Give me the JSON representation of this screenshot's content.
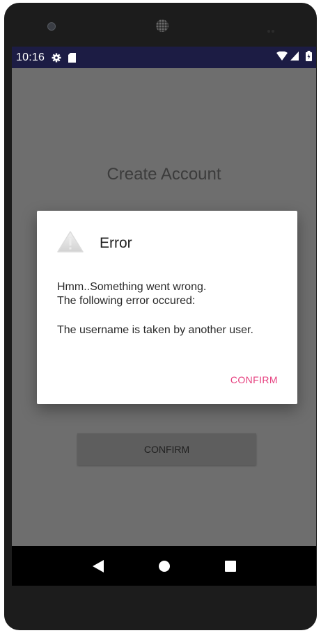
{
  "status_bar": {
    "time": "10:16"
  },
  "screen": {
    "title": "Create Account",
    "confirm_label": "CONFIRM"
  },
  "dialog": {
    "title": "Error",
    "message_line1": "Hmm..Something went wrong.",
    "message_line2": "The following error occured:",
    "message_line3": "The username is taken by another user.",
    "confirm_label": "CONFIRM"
  },
  "icons": {
    "status": [
      "gear-icon",
      "sd-card-icon",
      "wifi-icon",
      "signal-icon",
      "battery-icon"
    ],
    "dialog": "warning-icon",
    "nav": [
      "back-icon",
      "home-icon",
      "recents-icon"
    ]
  },
  "colors": {
    "status_bar": "#1c1c44",
    "scrim_background": "#6e6e6e",
    "dialog_background": "#ffffff",
    "dialog_action": "#e6407f",
    "nav_bar": "#000000"
  }
}
